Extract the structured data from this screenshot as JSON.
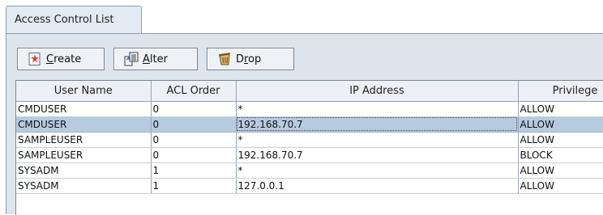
{
  "tab": {
    "label": "Access Control List"
  },
  "toolbar": {
    "create": {
      "prefix": "",
      "mnemonic": "C",
      "rest": "reate",
      "icon": "new-item-icon"
    },
    "alter": {
      "prefix": "",
      "mnemonic": "A",
      "rest": "lter",
      "icon": "edit-document-icon"
    },
    "drop": {
      "prefix": "D",
      "mnemonic": "r",
      "rest": "op",
      "icon": "delete-bin-icon"
    }
  },
  "table": {
    "columns": [
      "User Name",
      "ACL Order",
      "IP Address",
      "Privilege"
    ],
    "rows": [
      [
        "CMDUSER",
        "0",
        "*",
        "ALLOW"
      ],
      [
        "CMDUSER",
        "0",
        "192.168.70.7",
        "ALLOW"
      ],
      [
        "SAMPLEUSER",
        "0",
        "*",
        "ALLOW"
      ],
      [
        "SAMPLEUSER",
        "0",
        "192.168.70.7",
        "BLOCK"
      ],
      [
        "SYSADM",
        "1",
        "*",
        "ALLOW"
      ],
      [
        "SYSADM",
        "1",
        "127.0.0.1",
        "ALLOW"
      ]
    ],
    "selected_row": 1
  },
  "colors": {
    "panel_bg": "#dde4ec",
    "selection": "#b7cbe0",
    "header_bg": "#edf0f4"
  }
}
